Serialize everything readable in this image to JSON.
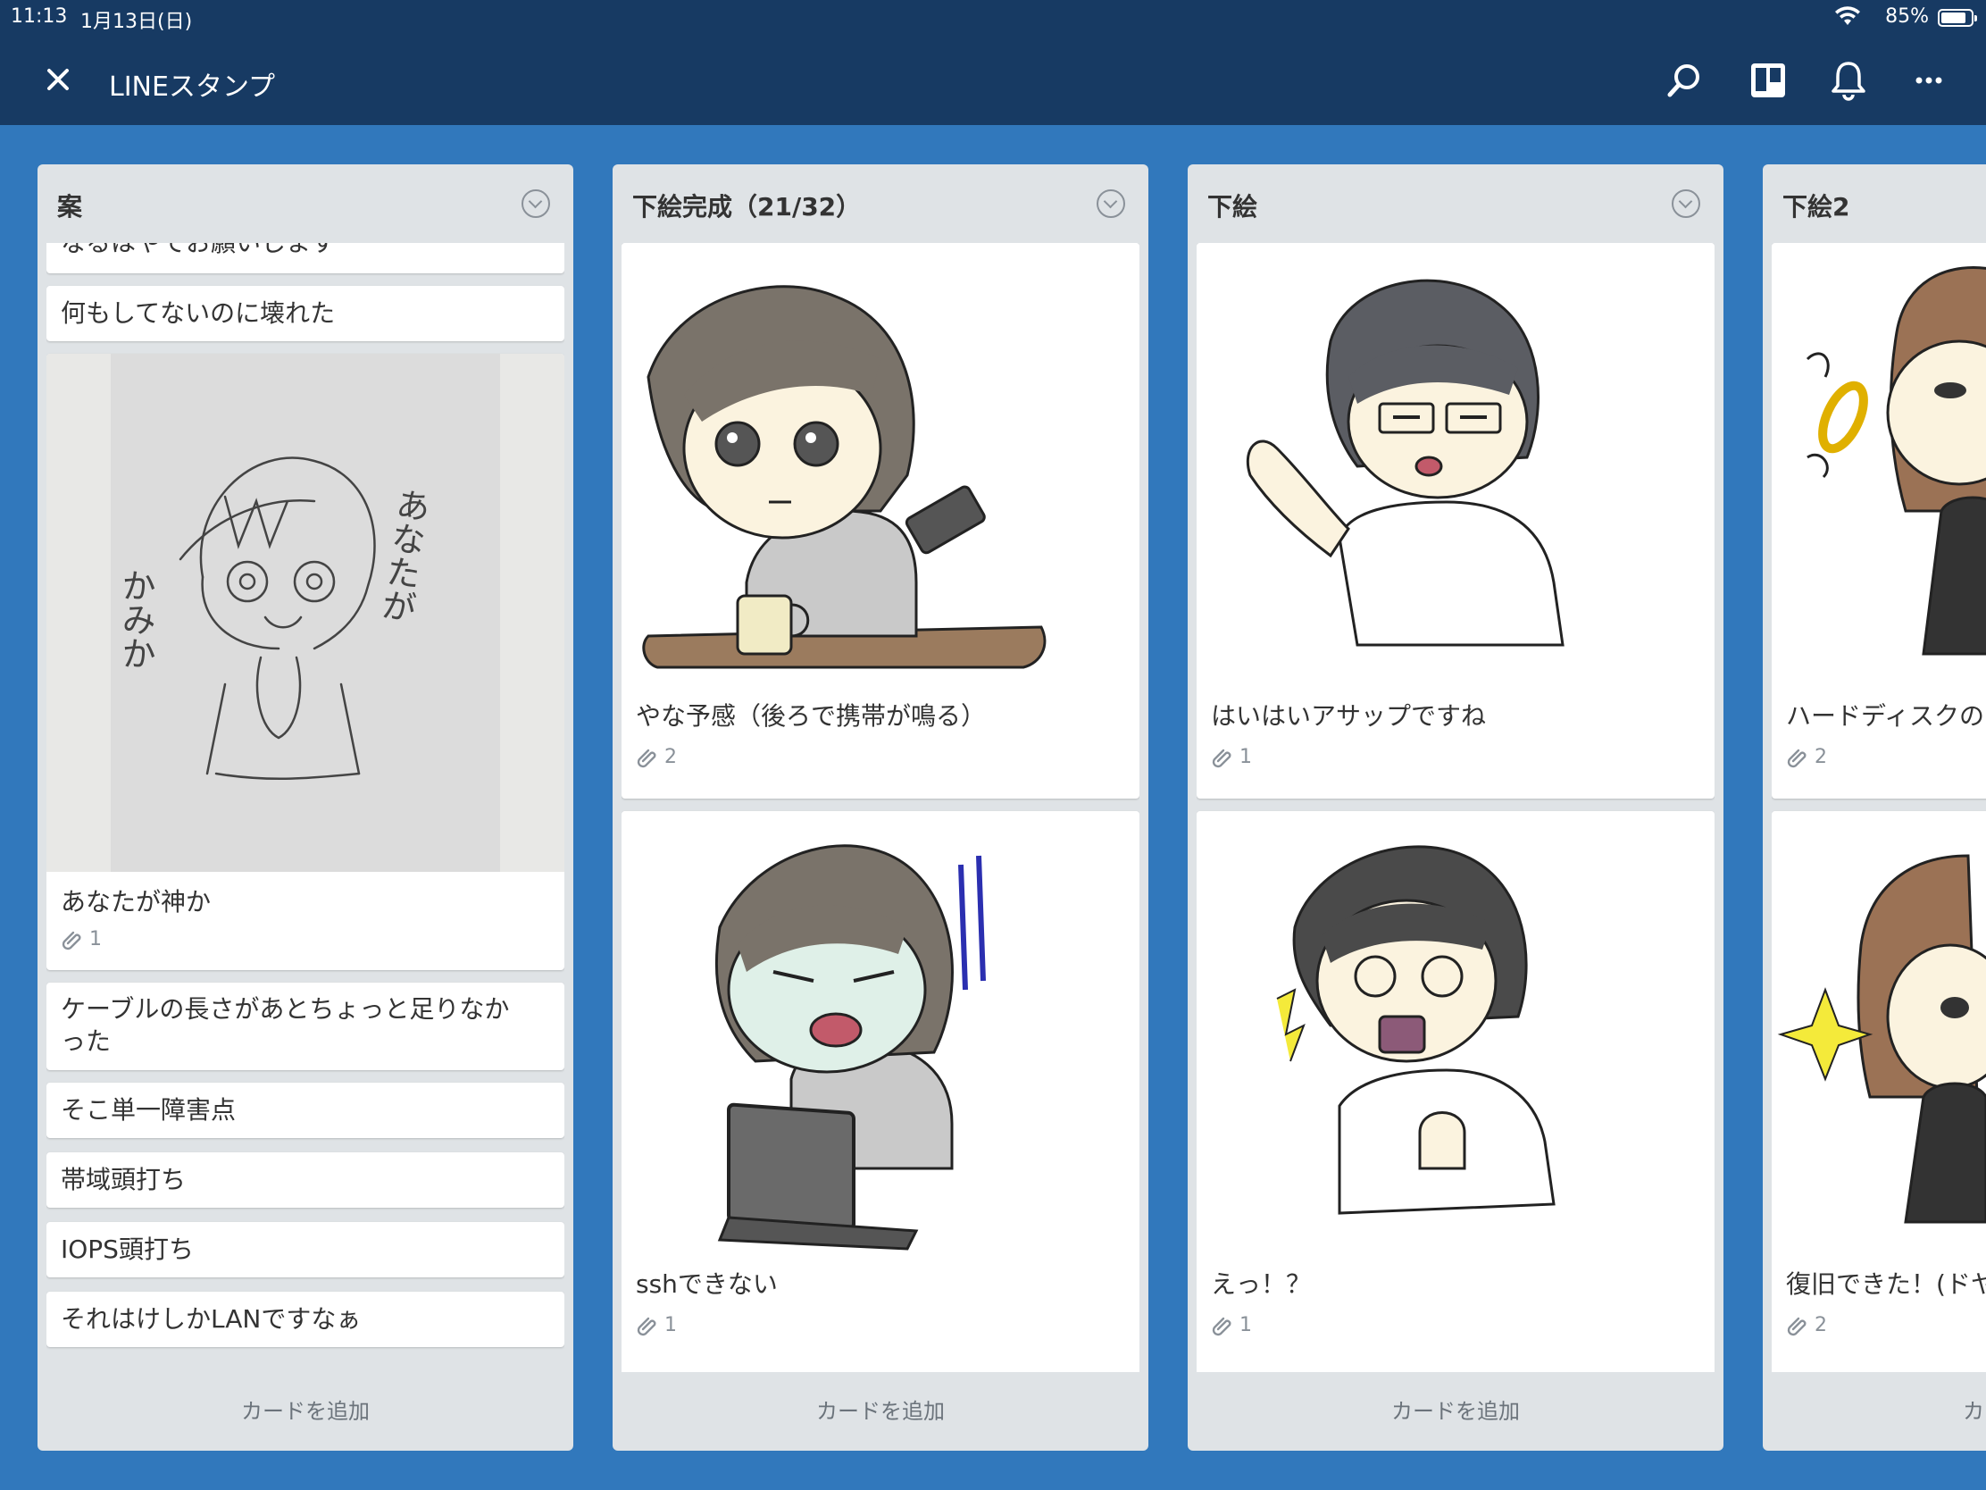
{
  "status_bar": {
    "time": "11:13",
    "date": "1月13日(日)",
    "wifi_icon": "wifi-icon",
    "battery_percent": "85%",
    "battery_level": 0.85
  },
  "header": {
    "close_icon": "close-icon",
    "board_title": "LINEスタンプ",
    "actions": [
      "search-icon",
      "board-view-icon",
      "bell-icon",
      "more-icon"
    ]
  },
  "colors": {
    "header_bg": "#173a63",
    "board_bg": "#3178bc",
    "list_bg": "#dfe3e6",
    "card_bg": "#ffffff"
  },
  "lists": [
    {
      "title": "案",
      "cards": [
        {
          "text": "なるはやでお願いします"
        },
        {
          "text": "何もしてないのに壊れた"
        },
        {
          "text": "あなたが神か",
          "attachments": "1",
          "cover_text": [
            "あなたが",
            "かみか"
          ]
        },
        {
          "text": "ケーブルの長さがあとちょっと足りなか",
          "text2": "った"
        },
        {
          "text": "そこ単一障害点"
        },
        {
          "text": "帯域頭打ち"
        },
        {
          "text": "IOPS頭打ち"
        },
        {
          "text": "それはけしかLANですなぁ"
        }
      ],
      "add_card": "カードを追加"
    },
    {
      "title": "下絵完成（21/32）",
      "cards": [
        {
          "text": "やな予感（後ろで携帯が鳴る）",
          "attachments": "2"
        },
        {
          "text": "sshできない",
          "attachments": "1"
        }
      ],
      "add_card": "カードを追加"
    },
    {
      "title": "下絵",
      "cards": [
        {
          "text": "はいはいアサップですね",
          "attachments": "1"
        },
        {
          "text": "えっ！？",
          "attachments": "1"
        }
      ],
      "add_card": "カードを追加"
    },
    {
      "title": "下絵2",
      "cards": [
        {
          "text": "ハードディスクの",
          "attachments": "2"
        },
        {
          "text": "復旧できた！(ドヤ",
          "attachments": "2"
        }
      ],
      "add_card": "カ"
    }
  ]
}
